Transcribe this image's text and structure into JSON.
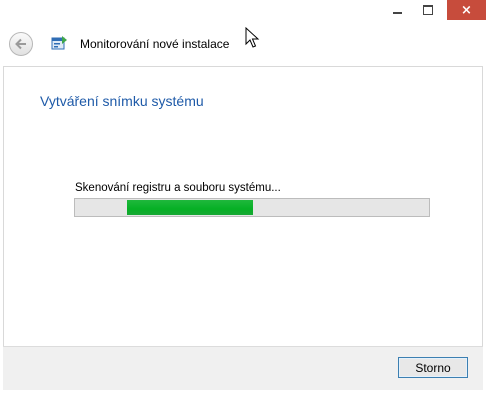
{
  "window": {
    "title": "Monitorování nové instalace",
    "controls": {
      "close_glyph": "×"
    }
  },
  "icons": {
    "back": "back-arrow-icon",
    "app": "installation-monitor-icon",
    "cursor": "mouse-cursor-icon"
  },
  "main": {
    "heading": "Vytváření snímku systému",
    "status": "Skenování registru a souboru systému...",
    "progress": {
      "start_fraction": 0.146,
      "end_fraction": 0.503,
      "color": "#06b025"
    }
  },
  "footer": {
    "cancel_label": "Storno"
  },
  "colors": {
    "heading": "#1e5aa8",
    "close_button": "#c74c3c"
  }
}
